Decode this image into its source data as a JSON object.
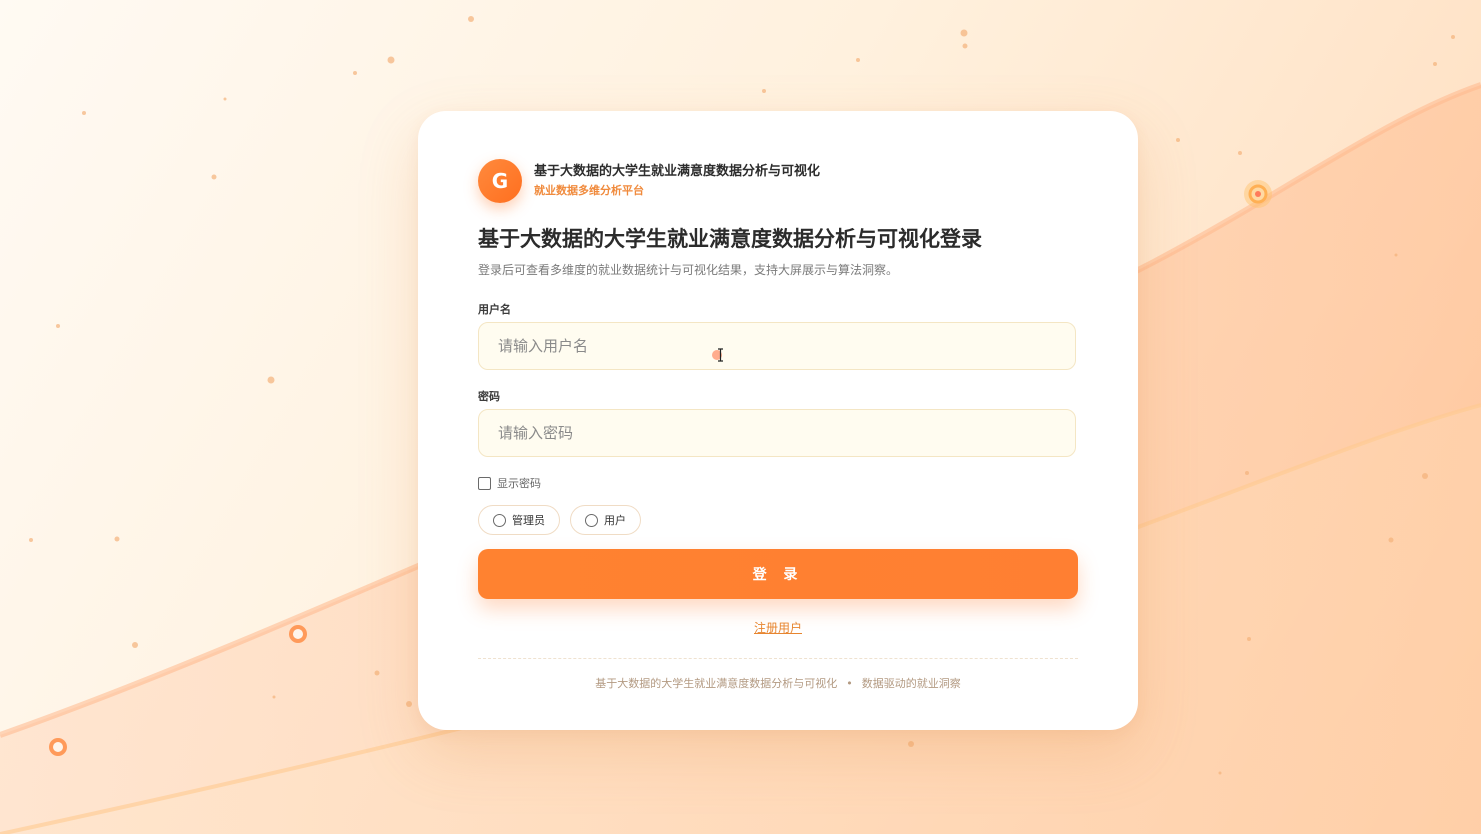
{
  "brand": {
    "logo_letter": "G",
    "title": "基于大数据的大学生就业满意度数据分析与可视化",
    "subtitle": "就业数据多维分析平台"
  },
  "page": {
    "title": "基于大数据的大学生就业满意度数据分析与可视化登录",
    "description": "登录后可查看多维度的就业数据统计与可视化结果，支持大屏展示与算法洞察。"
  },
  "form": {
    "username_label": "用户名",
    "username_placeholder": "请输入用户名",
    "username_value": "",
    "password_label": "密码",
    "password_placeholder": "请输入密码",
    "password_value": "",
    "show_password_label": "显示密码",
    "show_password_checked": false,
    "roles": [
      {
        "label": "管理员",
        "selected": false
      },
      {
        "label": "用户",
        "selected": false
      }
    ],
    "login_label": "登 录",
    "register_label": "注册用户"
  },
  "footer": {
    "left": "基于大数据的大学生就业满意度数据分析与可视化",
    "separator": "•",
    "right": "数据驱动的就业洞察"
  },
  "colors": {
    "accent": "#ff7f32",
    "accent_text": "#e7852f",
    "input_bg": "#fffcf0"
  }
}
